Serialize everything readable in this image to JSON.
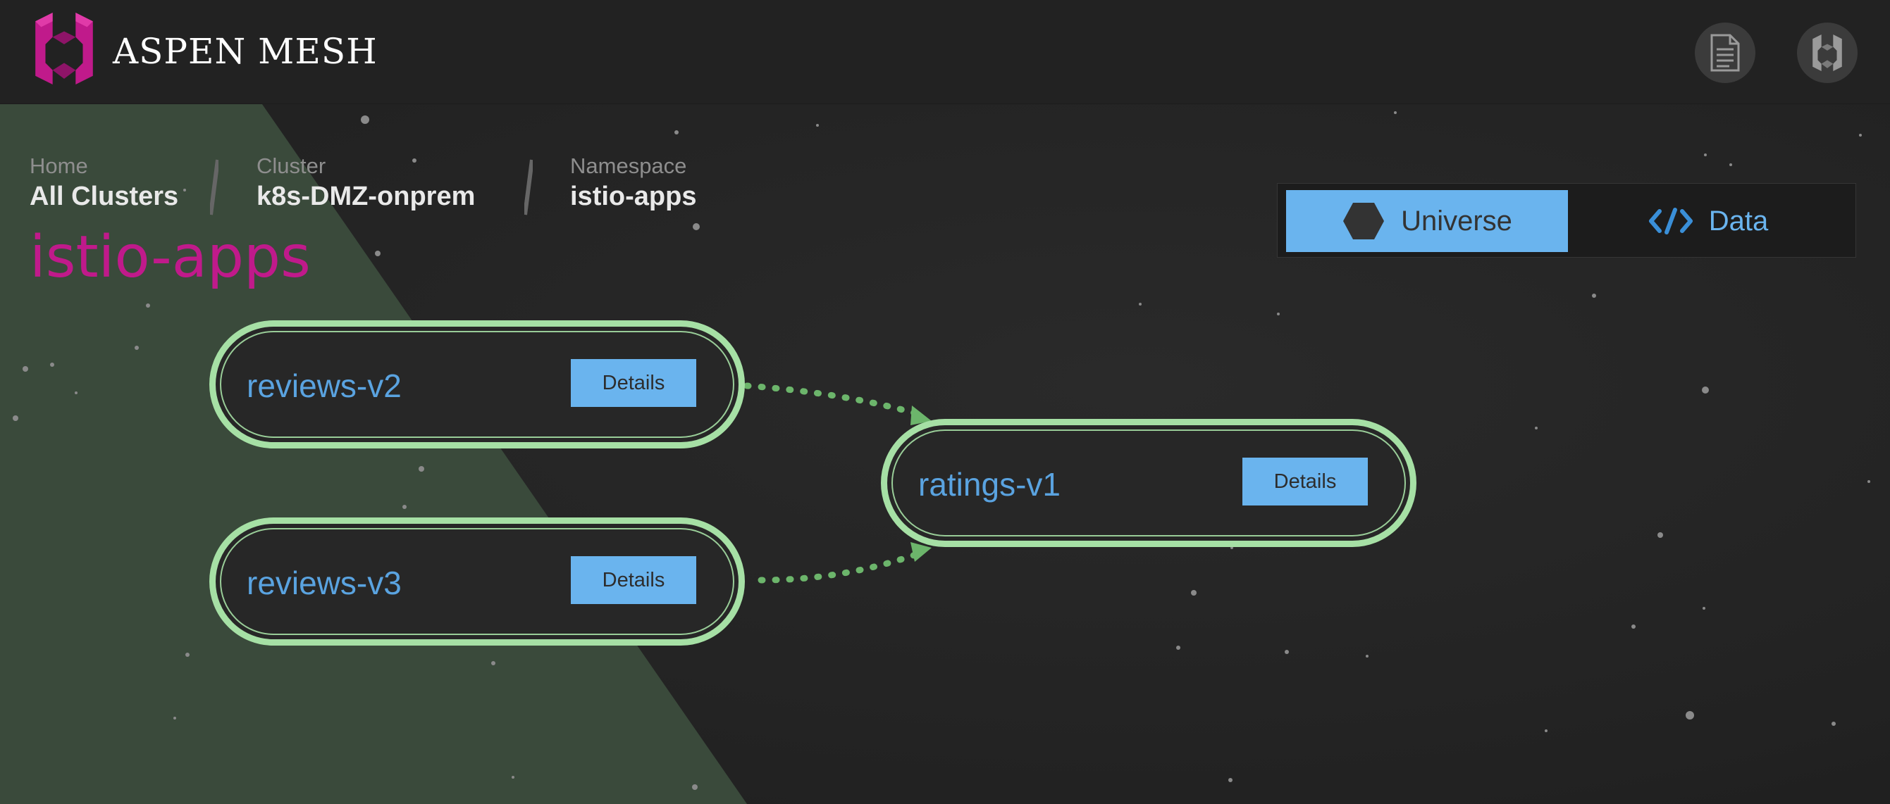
{
  "header": {
    "brand": "ASPEN MESH",
    "logo_icon": "aspen-mesh-logo-icon",
    "docs_icon": "document-icon",
    "mesh_icon": "aspen-mesh-icon"
  },
  "breadcrumb": {
    "home": {
      "label": "Home",
      "value": "All Clusters"
    },
    "cluster": {
      "label": "Cluster",
      "value": "k8s-DMZ-onprem"
    },
    "namespace": {
      "label": "Namespace",
      "value": "istio-apps"
    }
  },
  "namespace_title": "istio-apps",
  "view_toggle": {
    "options": [
      {
        "label": "Universe",
        "icon": "hexagon-icon",
        "selected": true
      },
      {
        "label": "Data",
        "icon": "code-icon",
        "selected": false
      }
    ]
  },
  "services": [
    {
      "name": "reviews-v2",
      "button": "Details"
    },
    {
      "name": "reviews-v3",
      "button": "Details"
    },
    {
      "name": "ratings-v1",
      "button": "Details"
    }
  ],
  "edges": [
    {
      "from": "reviews-v2",
      "to": "ratings-v1"
    },
    {
      "from": "reviews-v3",
      "to": "ratings-v1"
    }
  ],
  "colors": {
    "accent_blue": "#6ab4ee",
    "node_border": "#a6e0a5",
    "edge_green": "#6cb56b",
    "namespace_magenta": "#c01a8b",
    "wedge_green": "#3a4a3b"
  }
}
